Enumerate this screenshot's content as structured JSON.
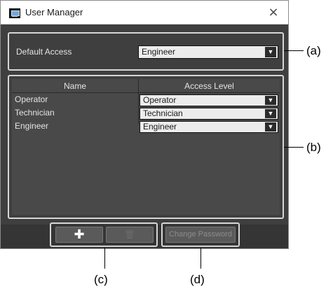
{
  "window": {
    "title": "User Manager",
    "close_glyph": "×",
    "app_icon": "monitor-icon"
  },
  "default_access": {
    "label": "Default Access",
    "value": "Engineer"
  },
  "table": {
    "columns": [
      "Name",
      "Access Level"
    ],
    "rows": [
      {
        "name": "Operator",
        "level": "Operator"
      },
      {
        "name": "Technician",
        "level": "Technician"
      },
      {
        "name": "Engineer",
        "level": "Engineer"
      }
    ]
  },
  "toolbar": {
    "add_glyph": "✚",
    "delete_glyph": "🗑",
    "change_password_label": "Change Password"
  },
  "dropdown_arrow": "▼",
  "annotations": {
    "a": "(a)",
    "b": "(b)",
    "c": "(c)",
    "d": "(d)"
  },
  "colors": {
    "window_bg": "#3f3f3f",
    "highlight_border": "#d6d6d6",
    "dropdown_bg": "#ececec"
  }
}
